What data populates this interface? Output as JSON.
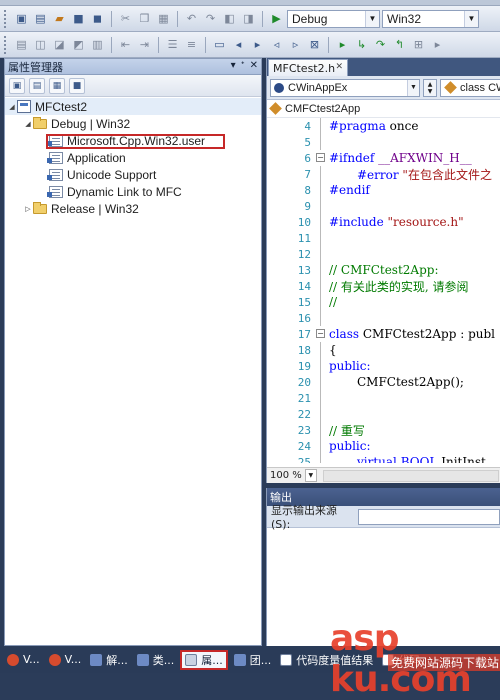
{
  "toolbar": {
    "configuration_value": "Debug",
    "platform_value": "Win32"
  },
  "property_manager": {
    "title": "属性管理器",
    "pin_glyph": "▾ ↕ ×",
    "tree": [
      {
        "label": "MFCtest2",
        "icon": "project-icon",
        "level": 0,
        "toggle": "◢"
      },
      {
        "label": "Debug | Win32",
        "icon": "folder-icon",
        "level": 1,
        "toggle": "◢"
      },
      {
        "label": "Microsoft.Cpp.Win32.user",
        "icon": "property-sheet-icon",
        "level": 2,
        "toggle": ""
      },
      {
        "label": "Application",
        "icon": "property-sheet-icon",
        "level": 2,
        "toggle": ""
      },
      {
        "label": "Unicode Support",
        "icon": "property-sheet-icon",
        "level": 2,
        "toggle": ""
      },
      {
        "label": "Dynamic Link to MFC",
        "icon": "property-sheet-icon",
        "level": 2,
        "toggle": ""
      },
      {
        "label": "Release | Win32",
        "icon": "folder-icon",
        "level": 1,
        "toggle": "▷"
      }
    ]
  },
  "editor": {
    "tab_label": "MFCtest2.h",
    "class_dropdown": "CWinAppEx",
    "member_dropdown": "class CW",
    "breadcrumb": "CMFCtest2App",
    "zoom": "100 %",
    "lines": [
      {
        "n": "4",
        "text": "#pragma once",
        "style": "code"
      },
      {
        "n": "5",
        "text": "",
        "style": "code"
      },
      {
        "n": "6",
        "text": "#ifndef __AFXWIN_H__",
        "style": "code",
        "fold": "minus"
      },
      {
        "n": "7",
        "text": "#error \"在包含此文件之",
        "style": "code",
        "indent": 1
      },
      {
        "n": "8",
        "text": "#endif",
        "style": "code"
      },
      {
        "n": "9",
        "text": "",
        "style": "code"
      },
      {
        "n": "10",
        "text": "#include \"resource.h\"",
        "style": "code"
      },
      {
        "n": "11",
        "text": "",
        "style": "code"
      },
      {
        "n": "12",
        "text": "",
        "style": "code"
      },
      {
        "n": "13",
        "text": "// CMFCtest2App:",
        "style": "comment"
      },
      {
        "n": "14",
        "text": "// 有关此类的实现, 请参阅",
        "style": "comment"
      },
      {
        "n": "15",
        "text": "//",
        "style": "comment"
      },
      {
        "n": "16",
        "text": "",
        "style": "code"
      },
      {
        "n": "17",
        "text": "class CMFCtest2App : publ",
        "style": "code",
        "fold": "minus"
      },
      {
        "n": "18",
        "text": "{",
        "style": "code"
      },
      {
        "n": "19",
        "text": "public:",
        "style": "code"
      },
      {
        "n": "20",
        "text": "CMFCtest2App();",
        "style": "code",
        "indent": 1
      },
      {
        "n": "21",
        "text": "",
        "style": "code"
      },
      {
        "n": "22",
        "text": "",
        "style": "code"
      },
      {
        "n": "23",
        "text": "// 重写",
        "style": "comment"
      },
      {
        "n": "24",
        "text": "public:",
        "style": "code"
      },
      {
        "n": "25",
        "text": "virtual BOOL InitInst",
        "style": "code",
        "indent": 1
      }
    ]
  },
  "output": {
    "title": "输出",
    "source_label": "显示输出来源(S):"
  },
  "bottom_tabs": [
    {
      "label": "V...",
      "icon": "red"
    },
    {
      "label": "V...",
      "icon": "red"
    },
    {
      "label": "解...",
      "icon": "blue"
    },
    {
      "label": "类...",
      "icon": "blue"
    },
    {
      "label": "属...",
      "icon": "gray",
      "active": true
    },
    {
      "label": "团...",
      "icon": "blue"
    },
    {
      "label": "代码度量值结果",
      "icon": "doc"
    },
    {
      "label": "代码...",
      "icon": "doc"
    }
  ],
  "watermark": {
    "logo_text": "asp ku.com",
    "subtitle": "免费网站源码下载站"
  },
  "colors": {
    "ide_background": "#2b3c59",
    "highlight_outline": "#c62828",
    "comment_green": "#007a00",
    "line_number_blue": "#2b91af"
  }
}
